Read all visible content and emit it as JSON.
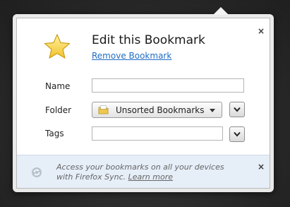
{
  "panel": {
    "title": "Edit this Bookmark",
    "remove_link": "Remove Bookmark",
    "close_symbol": "×"
  },
  "form": {
    "name_label": "Name",
    "name_value": "",
    "folder_label": "Folder",
    "folder_value": "Unsorted Bookmarks",
    "tags_label": "Tags",
    "tags_value": ""
  },
  "sync": {
    "message": "Access your bookmarks on all your devices with Firefox Sync.",
    "learn_more": "Learn more",
    "close_symbol": "×"
  },
  "icons": {
    "star": "star-icon",
    "folder": "folder-icon",
    "expand": "chevron-down-icon",
    "sync": "sync-icon"
  },
  "colors": {
    "link": "#1f6cc4",
    "star_fill": "#f7d23e",
    "sync_bar": "#e6eef8"
  }
}
